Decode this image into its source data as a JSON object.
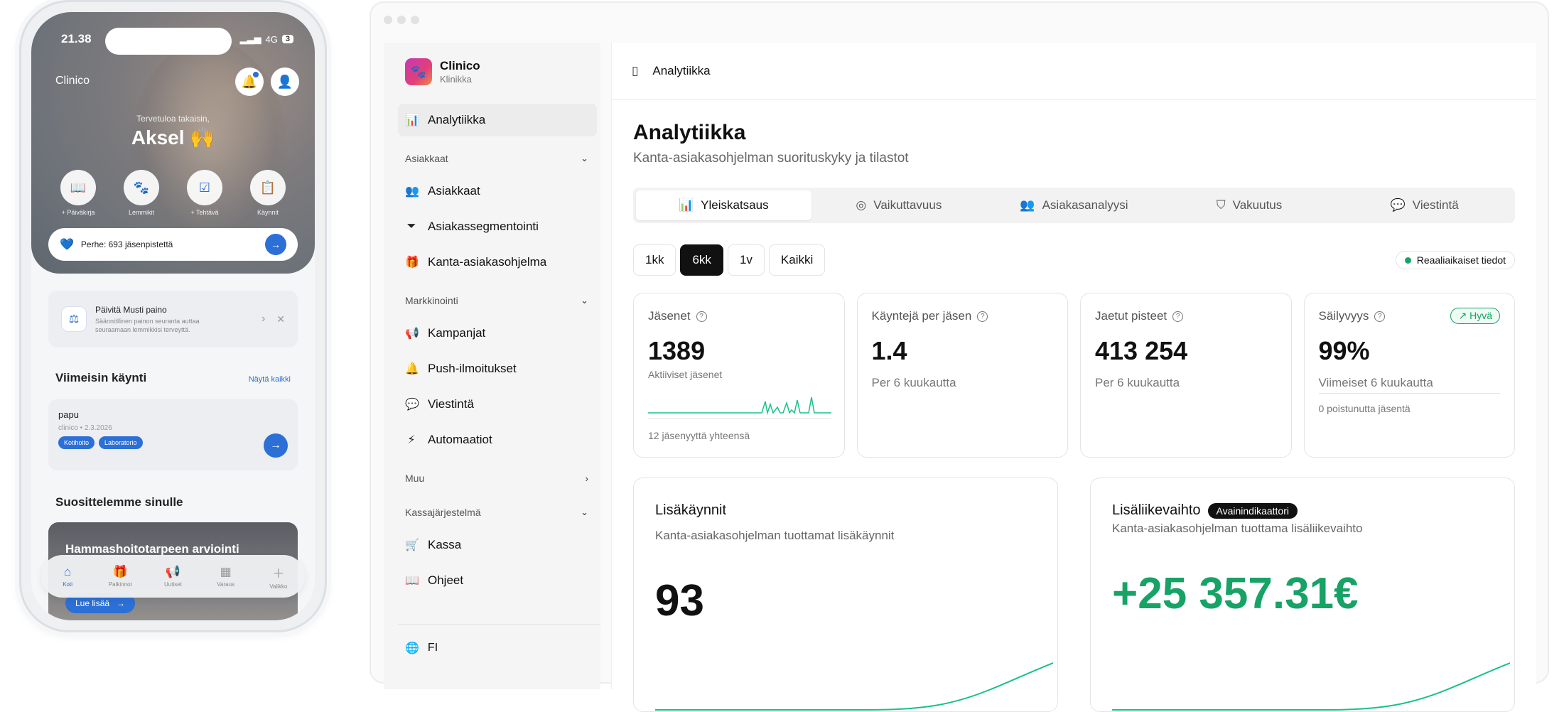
{
  "phone": {
    "status_time": "21.38",
    "network": "4G",
    "battery": "3",
    "brand": "Clinico",
    "welcome": "Tervetuloa takaisin,",
    "user_name": "Aksel 🙌",
    "quick_actions": [
      {
        "label": "+ Päiväkirja",
        "icon": "book-icon"
      },
      {
        "label": "Lemmikit",
        "icon": "paw-icon"
      },
      {
        "label": "+ Tehtävä",
        "icon": "checkbox-icon"
      },
      {
        "label": "Käynnit",
        "icon": "clipboard-icon"
      }
    ],
    "family_points": "Perhe: 693 jäsenpistettä",
    "promo": {
      "title": "Päivitä Musti paino",
      "text": "Säännöllinen painon seuranta auttaa seuraamaan lemmikkisi terveyttä."
    },
    "latest_visit": {
      "title": "Viimeisin käynti",
      "link": "Näytä kaikki",
      "name": "papu",
      "meta": "clinico  •  2.3.2026",
      "tags": [
        "Kotihoito",
        "Laboratorio"
      ]
    },
    "recommend": {
      "title": "Suosittelemme sinulle",
      "card_title": "Hammashoitotarpeen arviointi",
      "button": "Lue lisää"
    },
    "tabbar": [
      {
        "label": "Koti",
        "icon": "home-icon",
        "active": true
      },
      {
        "label": "Palkinnot",
        "icon": "gift-icon",
        "active": false
      },
      {
        "label": "Uutiset",
        "icon": "megaphone-icon",
        "active": false
      },
      {
        "label": "Varaus",
        "icon": "calendar-icon",
        "active": false
      },
      {
        "label": "Valikko",
        "icon": "plus-icon",
        "active": false
      }
    ]
  },
  "sidebar": {
    "brand_name": "Clinico",
    "brand_sub": "Klinikka",
    "active_item": "Analytiikka",
    "groups": [
      {
        "title": "Asiakkaat",
        "items": [
          "Asiakkaat",
          "Asiakassegmentointi",
          "Kanta-asiakasohjelma"
        ]
      },
      {
        "title": "Markkinointi",
        "items": [
          "Kampanjat",
          "Push-ilmoitukset",
          "Viestintä",
          "Automaatiot"
        ]
      },
      {
        "title": "Muu",
        "items": []
      },
      {
        "title": "Kassajärjestelmä",
        "items": [
          "Kassa",
          "Ohjeet"
        ]
      }
    ],
    "language": "FI"
  },
  "topbar": {
    "title": "Analytiikka"
  },
  "page": {
    "title": "Analytiikka",
    "subtitle": "Kanta-asiakasohjelman suorituskyky ja tilastot",
    "tabs": [
      "Yleiskatsaus",
      "Vaikuttavuus",
      "Asiakasanalyysi",
      "Vakuutus",
      "Viestintä"
    ],
    "ranges": [
      "1kk",
      "6kk",
      "1v",
      "Kaikki"
    ],
    "active_range": "6kk",
    "live_label": "Reaaliaikaiset tiedot"
  },
  "stats": [
    {
      "label": "Jäsenet",
      "value": "1389",
      "small": "Aktiiviset jäsenet",
      "foot": "12 jäsenyyttä yhteensä"
    },
    {
      "label": "Käyntejä per jäsen",
      "value": "1.4",
      "sub": "Per 6 kuukautta"
    },
    {
      "label": "Jaetut pisteet",
      "value": "413 254",
      "sub": "Per 6 kuukautta"
    },
    {
      "label": "Säilyvyys",
      "value": "99%",
      "sub": "Viimeiset 6 kuukautta",
      "badge": "Hyvä",
      "foot": "0 poistunutta jäsentä"
    }
  ],
  "cards": [
    {
      "title": "Lisäkäynnit",
      "subtitle": "Kanta-asiakasohjelman tuottamat lisäkäynnit",
      "value": "93"
    },
    {
      "title": "Lisäliikevaihto",
      "badge": "Avainindikaattori",
      "subtitle": "Kanta-asiakasohjelman tuottama lisäliikevaihto",
      "value": "+25 357.31€"
    }
  ],
  "colors": {
    "accent_blue": "#2c6fd6",
    "accent_green": "#17a266",
    "dark": "#111111"
  }
}
